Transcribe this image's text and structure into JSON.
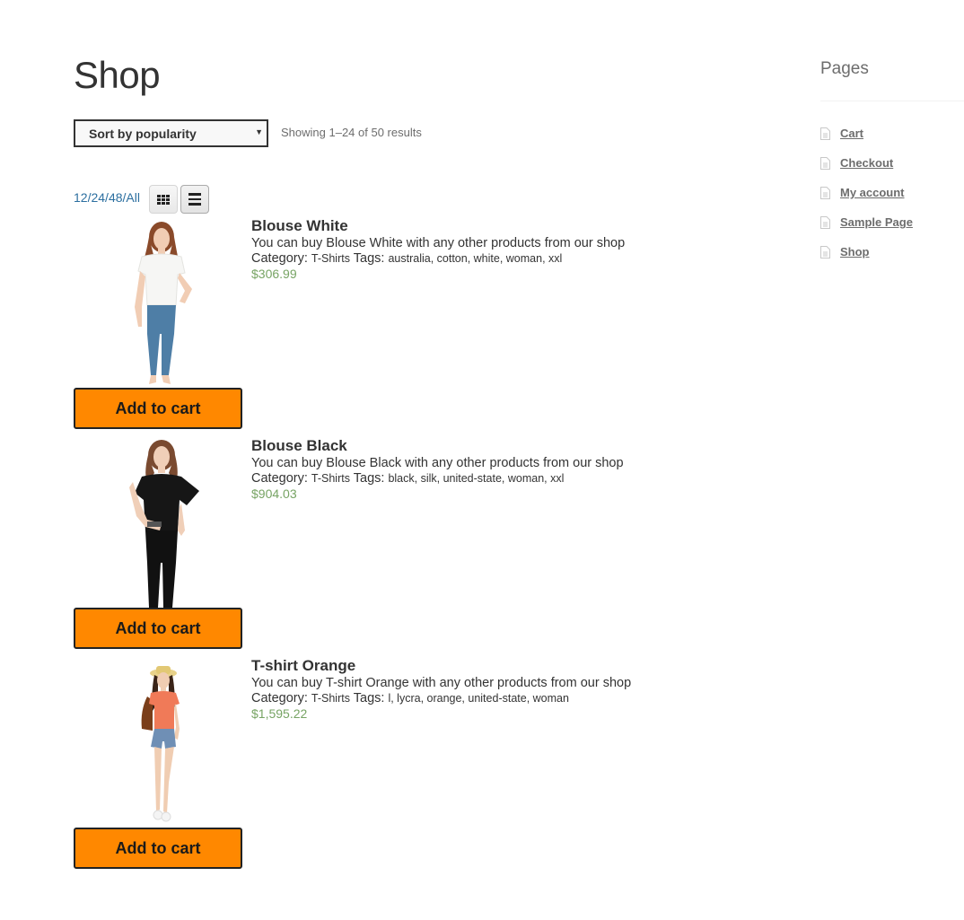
{
  "page": {
    "title": "Shop"
  },
  "toolbar": {
    "sort_selected": "Sort by popularity",
    "result_count": "Showing 1–24 of 50 results",
    "per_page_options": [
      "12",
      "24",
      "48",
      "All"
    ],
    "per_page_separator": "/",
    "view_modes": [
      {
        "name": "grid",
        "icon": "grid-icon",
        "active": false
      },
      {
        "name": "list",
        "icon": "list-icon",
        "active": true
      }
    ]
  },
  "products": [
    {
      "name": "Blouse White",
      "description": "You can buy Blouse White with any other products from our shop",
      "category_label": "Category:",
      "category": "T-Shirts",
      "tags_label": "Tags:",
      "tags": "australia, cotton, white, woman, xxl",
      "price": "$306.99",
      "button": "Add to cart",
      "image": "model-white-blouse-jeans"
    },
    {
      "name": "Blouse Black",
      "description": "You can buy Blouse Black with any other products from our shop",
      "category_label": "Category:",
      "category": "T-Shirts",
      "tags_label": "Tags:",
      "tags": "black, silk, united-state, woman, xxl",
      "price": "$904.03",
      "button": "Add to cart",
      "image": "model-black-blouse"
    },
    {
      "name": "T-shirt Orange",
      "description": "You can buy T-shirt Orange with any other products from our shop",
      "category_label": "Category:",
      "category": "T-Shirts",
      "tags_label": "Tags:",
      "tags": "l, lycra, orange, united-state, woman",
      "price": "$1,595.22",
      "button": "Add to cart",
      "image": "model-orange-tshirt-shorts"
    }
  ],
  "sidebar": {
    "title": "Pages",
    "items": [
      {
        "label": "Cart",
        "icon": "page-icon"
      },
      {
        "label": "Checkout",
        "icon": "page-icon"
      },
      {
        "label": "My account",
        "icon": "page-icon"
      },
      {
        "label": "Sample Page",
        "icon": "page-icon"
      },
      {
        "label": "Shop",
        "icon": "page-icon"
      }
    ]
  },
  "colors": {
    "button_bg": "#ff8800",
    "price": "#77a464",
    "link": "#2c6fa0",
    "text": "#333333"
  }
}
